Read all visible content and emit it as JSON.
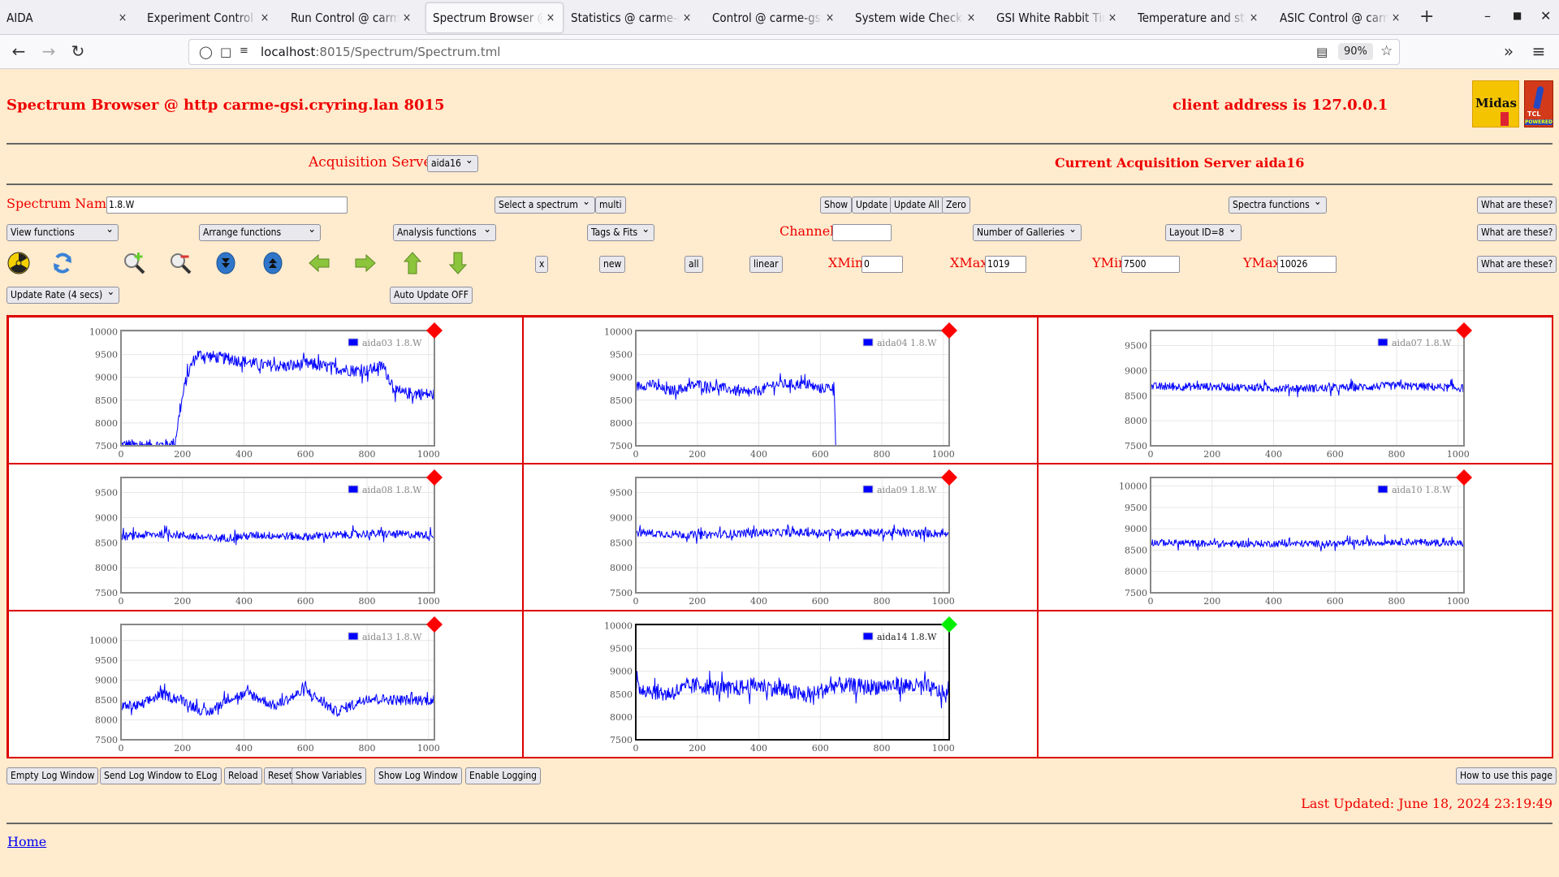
{
  "browser": {
    "tabs": [
      {
        "label": "AIDA",
        "active": false
      },
      {
        "label": "Experiment Control @ carme-gsi",
        "active": false
      },
      {
        "label": "Run Control @ carme-gsi",
        "active": false
      },
      {
        "label": "Spectrum Browser @ carme-gsi",
        "active": true
      },
      {
        "label": "Statistics @ carme-gsi",
        "active": false
      },
      {
        "label": "Control @ carme-gsi",
        "active": false
      },
      {
        "label": "System wide Checks @ carme-gsi",
        "active": false
      },
      {
        "label": "GSI White Rabbit Timing",
        "active": false
      },
      {
        "label": "Temperature and status",
        "active": false
      },
      {
        "label": "ASIC Control @ carme-gsi",
        "active": false
      }
    ],
    "url_host": "localhost",
    "url_rest": ":8015/Spectrum/Spectrum.tml",
    "zoom_level": "90%"
  },
  "header": {
    "title": "Spectrum Browser @ http carme-gsi.cryring.lan 8015",
    "client_address": "client address is 127.0.0.1",
    "logo_midas": "Midas",
    "logo_tcl": "TCL",
    "logo_tcl_powered": "POWERED"
  },
  "acquisition": {
    "label": "Acquisition Servers",
    "selected_server": "aida16",
    "current_label": "Current Acquisition Server aida16"
  },
  "controls": {
    "spectrum_name_label": "Spectrum Name:",
    "spectrum_name_value": "1.8.W",
    "select_spectrum": "Select a spectrum",
    "multi": "multi",
    "show": "Show",
    "update": "Update",
    "update_all": "Update All",
    "zero": "Zero",
    "spectra_functions": "Spectra functions",
    "what_are_these": "What are these?",
    "view_functions": "View functions",
    "arrange_functions": "Arrange functions",
    "analysis_functions": "Analysis functions",
    "tags_fits": "Tags & Fits",
    "channel_label": "Channel:",
    "channel_value": "",
    "number_of_galleries": "Number of Galleries",
    "layout_id": "Layout ID=8",
    "x_button": "x",
    "new_button": "new",
    "all_button": "all",
    "linear_button": "linear",
    "xmin_label": "XMin",
    "xmin_value": "0",
    "xmax_label": "XMax",
    "xmax_value": "1019",
    "ymin_label": "YMin",
    "ymin_value": "7500",
    "ymax_label": "YMax",
    "ymax_value": "10026",
    "update_rate": "Update Rate (4 secs)",
    "auto_update": "Auto Update OFF"
  },
  "toolbar_icons": [
    {
      "name": "radiation-icon"
    },
    {
      "name": "refresh-icon"
    },
    {
      "name": "zoom-in-icon"
    },
    {
      "name": "zoom-out-icon"
    },
    {
      "name": "expand-down-icon"
    },
    {
      "name": "expand-up-icon"
    },
    {
      "name": "arrow-left-icon"
    },
    {
      "name": "arrow-right-icon"
    },
    {
      "name": "arrow-up-icon"
    },
    {
      "name": "arrow-down-icon"
    }
  ],
  "footer": {
    "buttons": [
      "Empty Log Window",
      "Send Log Window to ELog",
      "Reload",
      "Reset",
      "Show Variables",
      "Show Log Window",
      "Enable Logging"
    ],
    "how_to": "How to use this page",
    "last_updated": "Last Updated: June 18, 2024 23:19:49",
    "home_link": "Home"
  },
  "colors": {
    "page_bg": "#ffebcd",
    "accent_red": "#ee0000",
    "series_blue": "#0000ff",
    "status_red": "#ff0000",
    "status_green": "#00ee00"
  },
  "chart_data": [
    {
      "type": "line",
      "legend": "aida03 1.8.W",
      "status": "red",
      "selected": false,
      "xlim": [
        0,
        1019
      ],
      "ylim": [
        7500,
        10026
      ],
      "xticks": [
        0,
        200,
        400,
        600,
        800,
        1000
      ],
      "yticks": [
        7500,
        8000,
        8500,
        9000,
        9500,
        10000
      ],
      "grid": true,
      "legend_position": "top-right",
      "x": [
        0,
        80,
        150,
        175,
        190,
        210,
        230,
        250,
        300,
        350,
        400,
        450,
        500,
        550,
        600,
        650,
        700,
        750,
        800,
        850,
        870,
        900,
        950,
        1019
      ],
      "values": [
        7520,
        7500,
        7520,
        7550,
        8200,
        8900,
        9300,
        9500,
        9450,
        9400,
        9350,
        9280,
        9250,
        9240,
        9300,
        9250,
        9200,
        9150,
        9150,
        9250,
        9000,
        8650,
        8650,
        8620
      ],
      "noise": 130
    },
    {
      "type": "line",
      "legend": "aida04 1.8.W",
      "status": "red",
      "selected": false,
      "xlim": [
        0,
        1019
      ],
      "ylim": [
        7500,
        10026
      ],
      "xticks": [
        0,
        200,
        400,
        600,
        800,
        1000
      ],
      "yticks": [
        7500,
        8000,
        8500,
        9000,
        9500,
        10000
      ],
      "grid": true,
      "legend_position": "top-right",
      "x": [
        0,
        50,
        100,
        150,
        200,
        250,
        300,
        350,
        400,
        450,
        500,
        550,
        600,
        645,
        650,
        652
      ],
      "values": [
        8800,
        8850,
        8700,
        8750,
        8850,
        8800,
        8750,
        8650,
        8700,
        8850,
        8850,
        8850,
        8750,
        8800,
        7500,
        7500
      ],
      "noise": 110
    },
    {
      "type": "line",
      "legend": "aida07 1.8.W",
      "status": "red",
      "selected": false,
      "xlim": [
        0,
        1019
      ],
      "ylim": [
        7500,
        9800
      ],
      "xticks": [
        0,
        200,
        400,
        600,
        800,
        1000
      ],
      "yticks": [
        7500,
        8000,
        8500,
        9000,
        9500
      ],
      "grid": true,
      "legend_position": "top-right",
      "x": [
        0,
        200,
        400,
        600,
        800,
        1019
      ],
      "values": [
        8680,
        8680,
        8650,
        8650,
        8700,
        8650
      ],
      "noise": 80
    },
    {
      "type": "line",
      "legend": "aida08 1.8.W",
      "status": "red",
      "selected": false,
      "xlim": [
        0,
        1019
      ],
      "ylim": [
        7500,
        9800
      ],
      "xticks": [
        0,
        200,
        400,
        600,
        800,
        1000
      ],
      "yticks": [
        7500,
        8000,
        8500,
        9000,
        9500
      ],
      "grid": true,
      "legend_position": "top-right",
      "x": [
        0,
        150,
        300,
        450,
        600,
        800,
        1019
      ],
      "values": [
        8620,
        8680,
        8580,
        8650,
        8620,
        8680,
        8650
      ],
      "noise": 80
    },
    {
      "type": "line",
      "legend": "aida09 1.8.W",
      "status": "red",
      "selected": false,
      "xlim": [
        0,
        1019
      ],
      "ylim": [
        7500,
        9800
      ],
      "xticks": [
        0,
        200,
        400,
        600,
        800,
        1000
      ],
      "yticks": [
        7500,
        8000,
        8500,
        9000,
        9500
      ],
      "grid": true,
      "legend_position": "top-right",
      "x": [
        0,
        200,
        400,
        600,
        800,
        1019
      ],
      "values": [
        8700,
        8650,
        8700,
        8700,
        8700,
        8680
      ],
      "noise": 80
    },
    {
      "type": "line",
      "legend": "aida10 1.8.W",
      "status": "red",
      "selected": false,
      "xlim": [
        0,
        1019
      ],
      "ylim": [
        7500,
        10200
      ],
      "xticks": [
        0,
        200,
        400,
        600,
        800,
        1000
      ],
      "yticks": [
        7500,
        8000,
        8500,
        9000,
        9500,
        10000
      ],
      "grid": true,
      "legend_position": "top-right",
      "x": [
        0,
        200,
        400,
        600,
        800,
        1019
      ],
      "values": [
        8680,
        8650,
        8650,
        8650,
        8700,
        8650
      ],
      "noise": 80
    },
    {
      "type": "line",
      "legend": "aida13 1.8.W",
      "status": "red",
      "selected": false,
      "xlim": [
        0,
        1019
      ],
      "ylim": [
        7500,
        10400
      ],
      "xticks": [
        0,
        200,
        400,
        600,
        800,
        1000
      ],
      "yticks": [
        7500,
        8000,
        8500,
        9000,
        9500,
        10000
      ],
      "grid": true,
      "legend_position": "top-right",
      "x": [
        0,
        60,
        130,
        200,
        280,
        350,
        420,
        500,
        600,
        700,
        800,
        900,
        1019
      ],
      "values": [
        8350,
        8350,
        8650,
        8500,
        8150,
        8550,
        8650,
        8350,
        8750,
        8200,
        8550,
        8500,
        8500
      ],
      "noise": 130
    },
    {
      "type": "line",
      "legend": "aida14 1.8.W",
      "status": "green",
      "selected": true,
      "xlim": [
        0,
        1019
      ],
      "ylim": [
        7500,
        10026
      ],
      "xticks": [
        0,
        200,
        400,
        600,
        800,
        1000
      ],
      "yticks": [
        7500,
        8000,
        8500,
        9000,
        9500,
        10000
      ],
      "grid": true,
      "legend_position": "top-right",
      "x": [
        0,
        100,
        200,
        300,
        400,
        500,
        560,
        650,
        750,
        850,
        950,
        1019
      ],
      "values": [
        8650,
        8500,
        8700,
        8600,
        8700,
        8550,
        8450,
        8700,
        8650,
        8700,
        8650,
        8450
      ],
      "noise": 180
    }
  ]
}
